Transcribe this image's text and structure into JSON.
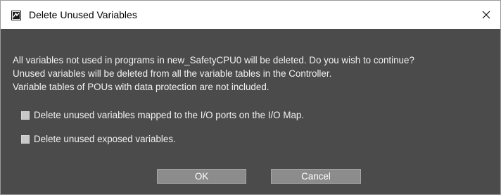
{
  "window": {
    "title": "Delete Unused Variables",
    "app_icon": "sysmac-app-icon",
    "close_icon": "close-icon"
  },
  "message": {
    "lines": [
      "All variables not used in programs in new_SafetyCPU0 will be deleted. Do you wish to continue?",
      "Unused variables will be deleted from all the variable tables in the Controller.",
      "Variable tables of POUs with data protection are not included."
    ]
  },
  "options": [
    {
      "label": "Delete unused variables mapped to the I/O ports on the I/O Map.",
      "checked": false
    },
    {
      "label": "Delete unused exposed variables.",
      "checked": false
    }
  ],
  "buttons": {
    "ok_label": "OK",
    "cancel_label": "Cancel"
  },
  "colors": {
    "dialog_background": "#4b4b4b",
    "button_background": "#8c8c8c",
    "checkbox_fill": "#c8c8c8",
    "text": "#f2f2f2"
  }
}
